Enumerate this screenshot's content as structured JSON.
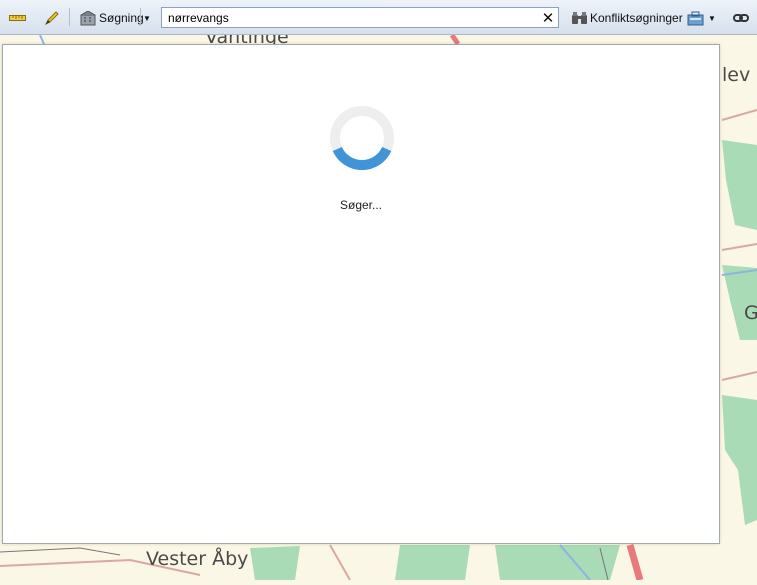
{
  "toolbar": {
    "search_button_label": "Søgning",
    "search_input_value": "nørrevangs",
    "conflict_label": "Konfliktsøgninger"
  },
  "map": {
    "place_top": "Vantinge",
    "place_right_top": "lev",
    "place_right_mid": "G",
    "place_bottom": "Vester Åby"
  },
  "dialog": {
    "loading_text": "Søger..."
  },
  "colors": {
    "toolbar_bg": "#dfe7f1",
    "map_bg": "#fbf7e6",
    "forest": "#a8dbb6",
    "road": "#e87a7a",
    "spinner_track": "#eeeeee",
    "spinner_active": "#3f95d8"
  }
}
